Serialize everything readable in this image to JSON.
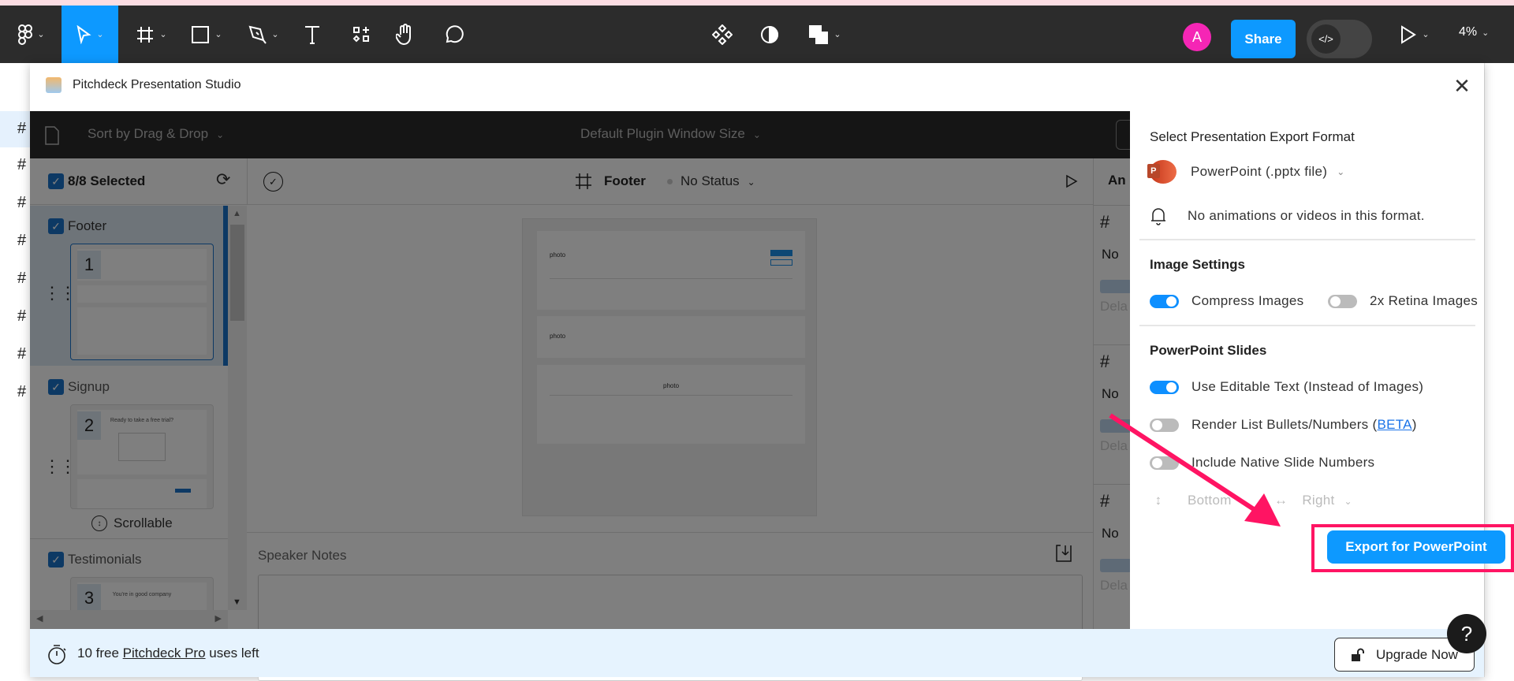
{
  "toolbar": {
    "share": "Share",
    "avatar_initial": "A",
    "zoom": "4%",
    "dev_mode_icon": "</>",
    "chevron": "⌄"
  },
  "plugin": {
    "title": "Pitchdeck Presentation Studio",
    "close": "✕",
    "sort_label": "Sort by Drag & Drop",
    "window_size_label": "Default Plugin Window Size"
  },
  "left_panel": {
    "selected_count": "8/8 Selected",
    "items": [
      {
        "label": "Footer",
        "number": "1"
      },
      {
        "label": "Signup",
        "number": "2",
        "thumb_heading": "Ready to take a free trial?",
        "badge": "Scrollable"
      },
      {
        "label": "Testimonials",
        "number": "3",
        "thumb_heading": "You're in good company"
      }
    ]
  },
  "center": {
    "frame_name": "Footer",
    "status": "No Status",
    "speaker_notes_label": "Speaker Notes",
    "preview_logo": "photo"
  },
  "right_partial": {
    "header": "An",
    "status": "No",
    "delay": "Dela"
  },
  "export": {
    "format_heading": "Select Presentation Export Format",
    "format_value": "PowerPoint (.pptx file)",
    "format_note": "No animations or videos in this format.",
    "image_heading": "Image Settings",
    "compress": {
      "label": "Compress Images",
      "on": true
    },
    "retina": {
      "label": "2x Retina Images",
      "on": false
    },
    "slides_heading": "PowerPoint Slides",
    "editable": {
      "label": "Use Editable Text (Instead of Images)",
      "on": true
    },
    "bullets": {
      "label_pre": "Render List Bullets/Numbers (",
      "link": "BETA",
      "label_post": ")",
      "on": false
    },
    "slide_numbers": {
      "label": "Include Native Slide Numbers",
      "on": false
    },
    "vertical_pos": "Bottom",
    "horizontal_pos": "Right",
    "export_button": "Export for PowerPoint"
  },
  "footer": {
    "prefix": "10 free ",
    "link": "Pitchdeck Pro",
    "suffix": " uses left",
    "upgrade": "Upgrade Now",
    "help": "?"
  },
  "colors": {
    "accent": "#0d99ff",
    "annotation": "#ff1463",
    "avatar": "#f526b5"
  }
}
